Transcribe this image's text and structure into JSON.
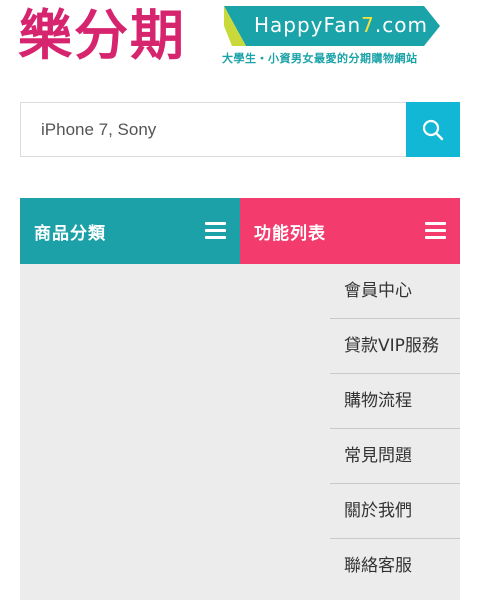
{
  "header": {
    "logo_cn_1": "樂",
    "logo_cn_2": "分",
    "logo_cn_3": "期",
    "badge_prefix": "HappyFan",
    "badge_seven": "7",
    "badge_suffix": ".com",
    "slogan": "大學生・小資男女最愛的分期購物網站",
    "colors": {
      "brand_pink": "#d6246e",
      "brand_teal": "#1aa3a8",
      "badge_yellow": "#f7e23b"
    }
  },
  "search": {
    "value": "",
    "placeholder": "iPhone 7, Sony",
    "button_icon": "search-icon",
    "button_color": "#11b7d5"
  },
  "bars": {
    "categories": {
      "label": "商品分類",
      "icon": "menu-icon",
      "color": "#1ba1a7"
    },
    "functions": {
      "label": "功能列表",
      "icon": "menu-icon",
      "color": "#f33b6e"
    }
  },
  "function_menu": {
    "items": [
      {
        "label": "會員中心"
      },
      {
        "label": "貸款VIP服務"
      },
      {
        "label": "購物流程"
      },
      {
        "label": "常見問題"
      },
      {
        "label": "關於我們"
      },
      {
        "label": "聯絡客服"
      }
    ]
  }
}
